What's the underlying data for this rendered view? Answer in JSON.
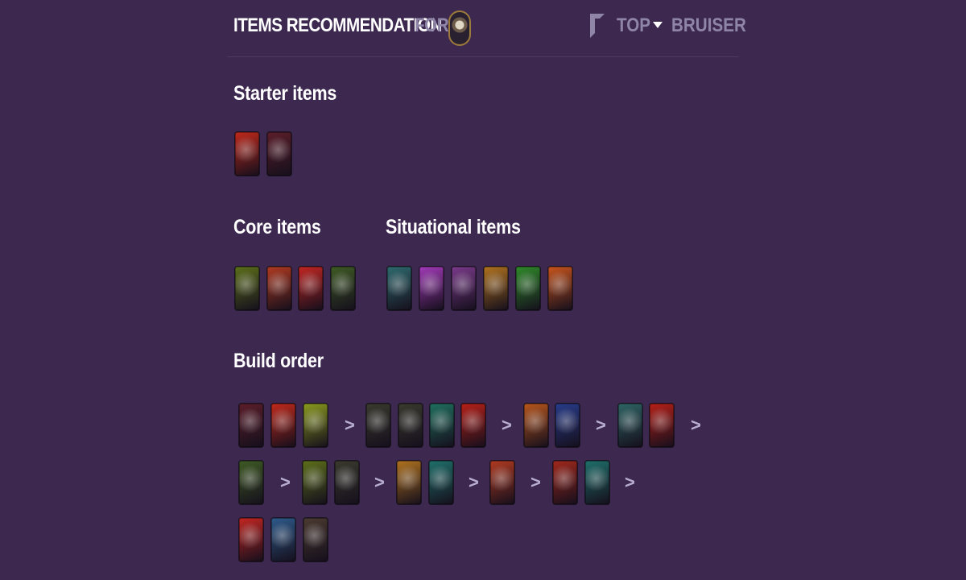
{
  "header": {
    "title": "ITEMS RECOMMENDATION",
    "for_label": "FOR",
    "champion_icon": "champion-portrait",
    "lane": "TOP",
    "role": "BRUISER"
  },
  "sections": {
    "starter": "Starter items",
    "core": "Core items",
    "situational": "Situational items",
    "build": "Build order"
  },
  "separator": ">",
  "colors": {
    "background": "#3d2850",
    "muted_text": "#8f85a6",
    "chevron": "#b8aed0"
  },
  "starter_items": [
    {
      "name": "starter-item-1-icon",
      "bg": "#c0291b"
    },
    {
      "name": "starter-item-2-icon",
      "bg": "#5a1e2a"
    }
  ],
  "core_items": [
    {
      "name": "core-item-1-icon",
      "bg": "#5c6f1a"
    },
    {
      "name": "core-item-2-icon",
      "bg": "#b03a20"
    },
    {
      "name": "core-item-3-icon",
      "bg": "#c22622"
    },
    {
      "name": "core-item-4-icon",
      "bg": "#3e5a24"
    }
  ],
  "situational_items": [
    {
      "name": "situational-item-1-icon",
      "bg": "#2e6a6e"
    },
    {
      "name": "situational-item-2-icon",
      "bg": "#a23ab8"
    },
    {
      "name": "situational-item-3-icon",
      "bg": "#7a3a8a"
    },
    {
      "name": "situational-item-4-icon",
      "bg": "#b0721e"
    },
    {
      "name": "situational-item-5-icon",
      "bg": "#2f8a2a"
    },
    {
      "name": "situational-item-6-icon",
      "bg": "#c8541c"
    }
  ],
  "build_order": [
    {
      "name": "build-item-1-icon",
      "bg": "#5a1e2a"
    },
    {
      "name": "build-item-2-icon",
      "bg": "#c0291b"
    },
    {
      "name": "build-item-3-icon",
      "bg": "#8a9a1e"
    },
    {
      "name": "build-item-4-icon",
      "bg": "#3a3a2e"
    },
    {
      "name": "build-item-5-icon",
      "bg": "#3a3a2e"
    },
    {
      "name": "build-item-6-icon",
      "bg": "#1f6f5e"
    },
    {
      "name": "build-item-7-icon",
      "bg": "#b62018"
    },
    {
      "name": "build-item-8-icon",
      "bg": "#b8561c"
    },
    {
      "name": "build-item-9-icon",
      "bg": "#283c8a"
    },
    {
      "name": "build-item-10-icon",
      "bg": "#2e6464"
    },
    {
      "name": "build-item-11-icon",
      "bg": "#b62018"
    },
    {
      "name": "build-item-12-icon",
      "bg": "#3e5a24"
    },
    {
      "name": "build-item-13-icon",
      "bg": "#5c6f1a"
    },
    {
      "name": "build-item-14-icon",
      "bg": "#3a3a2e"
    },
    {
      "name": "build-item-15-icon",
      "bg": "#b0721e"
    },
    {
      "name": "build-item-16-icon",
      "bg": "#1f6f6a"
    },
    {
      "name": "build-item-17-icon",
      "bg": "#b03a20"
    },
    {
      "name": "build-item-18-icon",
      "bg": "#a0281c"
    },
    {
      "name": "build-item-19-icon",
      "bg": "#1f6f6a"
    },
    {
      "name": "build-item-20-icon",
      "bg": "#c22622"
    },
    {
      "name": "build-item-21-icon",
      "bg": "#2e5a8a"
    },
    {
      "name": "build-item-22-icon",
      "bg": "#4a3a30"
    }
  ]
}
